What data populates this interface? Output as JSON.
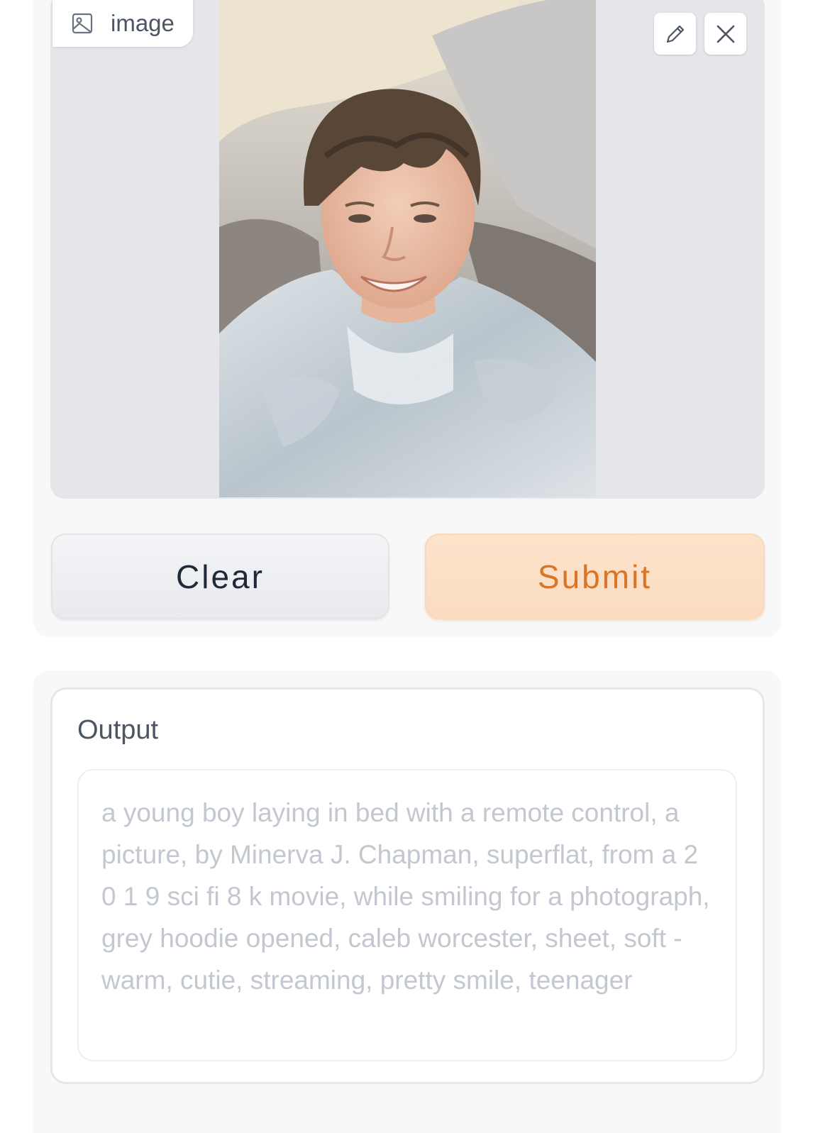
{
  "image_input": {
    "label": "image",
    "label_icon": "image-icon",
    "edit_icon": "pencil-icon",
    "clear_icon": "close-icon"
  },
  "actions": {
    "clear_label": "Clear",
    "submit_label": "Submit"
  },
  "output": {
    "label": "Output",
    "value": "a young boy laying in bed with a remote control, a picture, by Minerva J. Chapman, superflat, from a 2 0 1 9 sci fi 8 k movie, while smiling for a photograph, grey hoodie opened, caleb worcester, sheet, soft - warm, cutie, streaming, pretty smile, teenager"
  },
  "colors": {
    "submit_text": "#d97524",
    "submit_bg": "#fde3cb",
    "clear_text": "#1f2937",
    "panel_bg": "#e5e6ea"
  }
}
